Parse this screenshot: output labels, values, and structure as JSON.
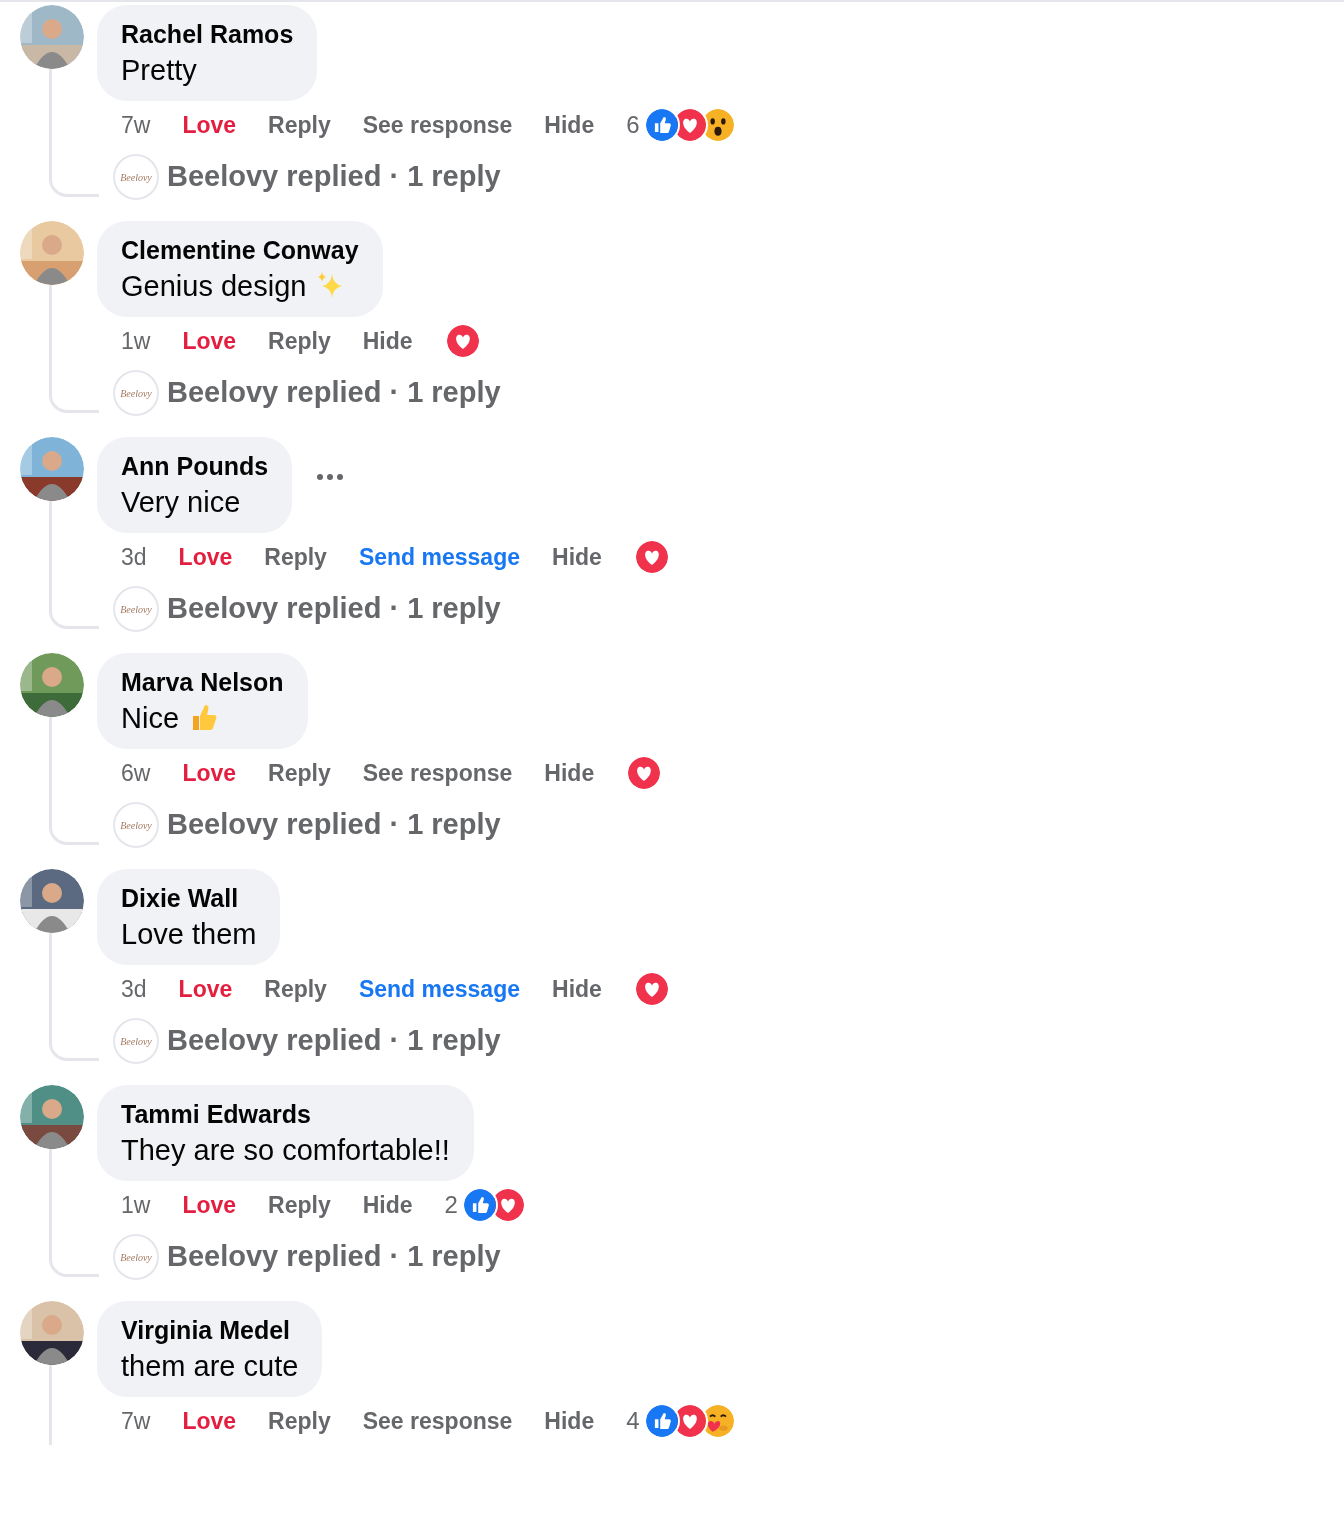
{
  "comments": [
    {
      "author": "Rachel Ramos",
      "text": "Pretty",
      "actions": [
        {
          "label": "7w",
          "kind": "time"
        },
        {
          "label": "Love",
          "kind": "love"
        },
        {
          "label": "Reply",
          "kind": "plain"
        },
        {
          "label": "See response",
          "kind": "plain"
        },
        {
          "label": "Hide",
          "kind": "plain"
        }
      ],
      "reactions": {
        "count": "6",
        "items": [
          {
            "kind": "like"
          },
          {
            "kind": "love"
          },
          {
            "kind": "wow"
          }
        ]
      },
      "reply_summary": {
        "logo_text": "Beelovy",
        "text": "Beelovy replied · 1 reply"
      }
    },
    {
      "author": "Clementine Conway",
      "text": "Genius design",
      "trailing_icon": {
        "kind": "sparkles"
      },
      "actions": [
        {
          "label": "1w",
          "kind": "time"
        },
        {
          "label": "Love",
          "kind": "love"
        },
        {
          "label": "Reply",
          "kind": "plain"
        },
        {
          "label": "Hide",
          "kind": "plain"
        }
      ],
      "reactions": {
        "items": [
          {
            "kind": "love"
          }
        ]
      },
      "reply_summary": {
        "logo_text": "Beelovy",
        "text": "Beelovy replied · 1 reply"
      }
    },
    {
      "author": "Ann Pounds",
      "text": "Very nice",
      "more_button": true,
      "actions": [
        {
          "label": "3d",
          "kind": "time"
        },
        {
          "label": "Love",
          "kind": "love"
        },
        {
          "label": "Reply",
          "kind": "plain"
        },
        {
          "label": "Send message",
          "kind": "link"
        },
        {
          "label": "Hide",
          "kind": "plain"
        }
      ],
      "reactions": {
        "items": [
          {
            "kind": "love"
          }
        ]
      },
      "reply_summary": {
        "logo_text": "Beelovy",
        "text": "Beelovy replied · 1 reply"
      }
    },
    {
      "author": "Marva Nelson",
      "text": "Nice",
      "trailing_icon": {
        "kind": "thumbs-up"
      },
      "actions": [
        {
          "label": "6w",
          "kind": "time"
        },
        {
          "label": "Love",
          "kind": "love"
        },
        {
          "label": "Reply",
          "kind": "plain"
        },
        {
          "label": "See response",
          "kind": "plain"
        },
        {
          "label": "Hide",
          "kind": "plain"
        }
      ],
      "reactions": {
        "items": [
          {
            "kind": "love"
          }
        ]
      },
      "reply_summary": {
        "logo_text": "Beelovy",
        "text": "Beelovy replied · 1 reply"
      }
    },
    {
      "author": "Dixie Wall",
      "text": "Love them",
      "actions": [
        {
          "label": "3d",
          "kind": "time"
        },
        {
          "label": "Love",
          "kind": "love"
        },
        {
          "label": "Reply",
          "kind": "plain"
        },
        {
          "label": "Send message",
          "kind": "link"
        },
        {
          "label": "Hide",
          "kind": "plain"
        }
      ],
      "reactions": {
        "items": [
          {
            "kind": "love"
          }
        ]
      },
      "reply_summary": {
        "logo_text": "Beelovy",
        "text": "Beelovy replied · 1 reply"
      }
    },
    {
      "author": "Tammi Edwards",
      "text": "They are so comfortable!!",
      "actions": [
        {
          "label": "1w",
          "kind": "time"
        },
        {
          "label": "Love",
          "kind": "love"
        },
        {
          "label": "Reply",
          "kind": "plain"
        },
        {
          "label": "Hide",
          "kind": "plain"
        }
      ],
      "reactions": {
        "count": "2",
        "items": [
          {
            "kind": "like"
          },
          {
            "kind": "love"
          }
        ]
      },
      "reply_summary": {
        "logo_text": "Beelovy",
        "text": "Beelovy replied · 1 reply"
      }
    },
    {
      "author": "Virginia Medel",
      "text": "them are cute",
      "actions": [
        {
          "label": "7w",
          "kind": "time"
        },
        {
          "label": "Love",
          "kind": "love"
        },
        {
          "label": "Reply",
          "kind": "plain"
        },
        {
          "label": "See response",
          "kind": "plain"
        },
        {
          "label": "Hide",
          "kind": "plain"
        }
      ],
      "reactions": {
        "count": "4",
        "items": [
          {
            "kind": "like"
          },
          {
            "kind": "love"
          },
          {
            "kind": "care"
          }
        ]
      }
    }
  ]
}
